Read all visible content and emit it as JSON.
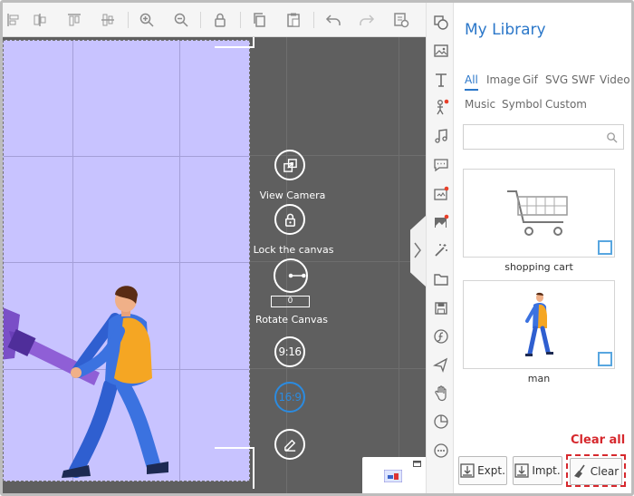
{
  "toolbar": {
    "icons": [
      "align-left-icon",
      "align-center-icon",
      "align-right-icon",
      "zoom-in-icon",
      "zoom-out-icon",
      "lock-icon",
      "copy-icon",
      "paste-icon",
      "undo-icon",
      "redo-icon",
      "preview-icon"
    ]
  },
  "canvas": {
    "artboard_color": "#c8c3ff",
    "controls": {
      "view_camera": "View Camera",
      "lock_canvas": "Lock the canvas",
      "rotation_value": "0",
      "rotate_canvas": "Rotate Canvas",
      "ratio_916": "9:16",
      "ratio_169": "16:9"
    }
  },
  "sidebar_icons": [
    "shapes-icon",
    "image-icon",
    "text-icon",
    "character-icon",
    "music-icon",
    "speech-bubble-icon",
    "sticker-icon",
    "photo-icon",
    "magic-wand-icon",
    "folder-icon",
    "save-icon",
    "flash-icon",
    "plane-icon",
    "hand-icon",
    "pie-chart-icon",
    "more-icon"
  ],
  "library": {
    "title": "My Library",
    "categories": [
      "All",
      "Image",
      "Gif",
      "SVG",
      "SWF",
      "Video",
      "Music",
      "Symbol",
      "Custom"
    ],
    "active_category": "All",
    "search_placeholder": "",
    "items": [
      {
        "label": "shopping cart"
      },
      {
        "label": "man"
      }
    ],
    "clear_all_label": "Clear all",
    "buttons": {
      "export": "Expt.",
      "import": "Impt.",
      "clear": "Clear"
    }
  },
  "colors": {
    "accent": "#2b77c9",
    "danger": "#d6282d",
    "canvas_bg": "#5f5f5f",
    "checkbox": "#58a6e0"
  }
}
